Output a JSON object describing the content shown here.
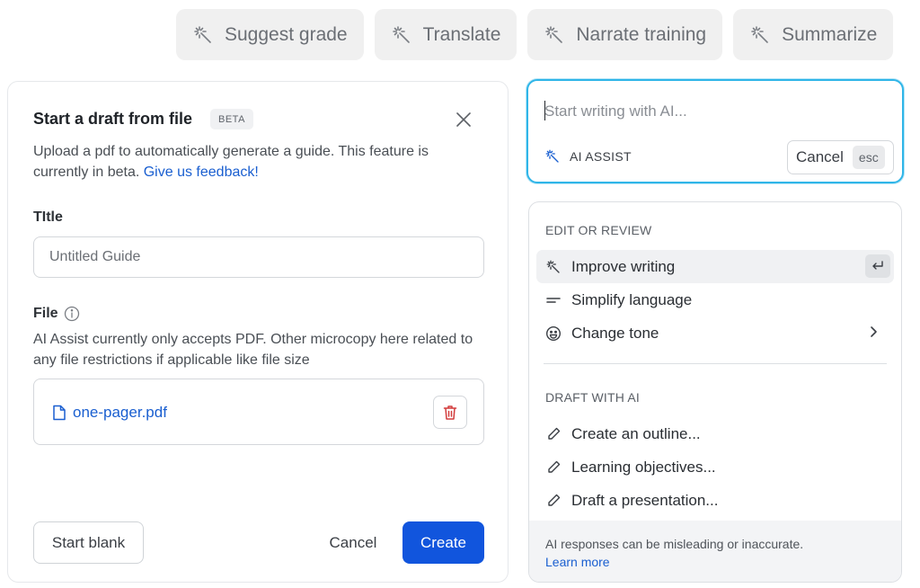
{
  "toolbar": {
    "pills": [
      {
        "label": "Suggest grade",
        "icon": "magic-wand-icon"
      },
      {
        "label": "Translate",
        "icon": "magic-wand-icon"
      },
      {
        "label": "Narrate training",
        "icon": "magic-wand-icon"
      },
      {
        "label": "Summarize",
        "icon": "magic-wand-icon"
      }
    ]
  },
  "draft_modal": {
    "title": "Start a draft from file",
    "badge": "BETA",
    "description": "Upload a pdf to automatically generate a guide. This feature is currently in beta.",
    "feedback_link": "Give us feedback!",
    "title_label": "TItle",
    "title_placeholder": "Untitled Guide",
    "file_label": "File",
    "file_help": "AI Assist currently only accepts PDF. Other microcopy here related to any file restrictions if applicable like file size",
    "file_name": "one-pager.pdf",
    "start_blank": "Start blank",
    "cancel": "Cancel",
    "create": "Create"
  },
  "ai_prompt": {
    "placeholder": "Start writing with AI...",
    "assist_label": "AI ASSIST",
    "cancel_label": "Cancel",
    "esc_key": "esc",
    "accent_color": "#2fb5e8"
  },
  "ai_menu": {
    "edit_section": "EDIT OR REVIEW",
    "edit_items": [
      {
        "label": "Improve writing",
        "icon": "magic-wand-icon"
      },
      {
        "label": "Simplify language",
        "icon": "lines-icon"
      },
      {
        "label": "Change tone",
        "icon": "smiley-icon"
      }
    ],
    "draft_section": "DRAFT WITH AI",
    "draft_items": [
      {
        "label": "Create an outline...",
        "icon": "pencil-icon"
      },
      {
        "label": "Learning objectives...",
        "icon": "pencil-icon"
      },
      {
        "label": "Draft a presentation...",
        "icon": "pencil-icon"
      }
    ],
    "disclaimer": "AI responses can be misleading or inaccurate.",
    "learn_more": "Learn more"
  },
  "colors": {
    "primary": "#1155dd",
    "link": "#1a5fd0",
    "danger": "#d23b3b"
  }
}
